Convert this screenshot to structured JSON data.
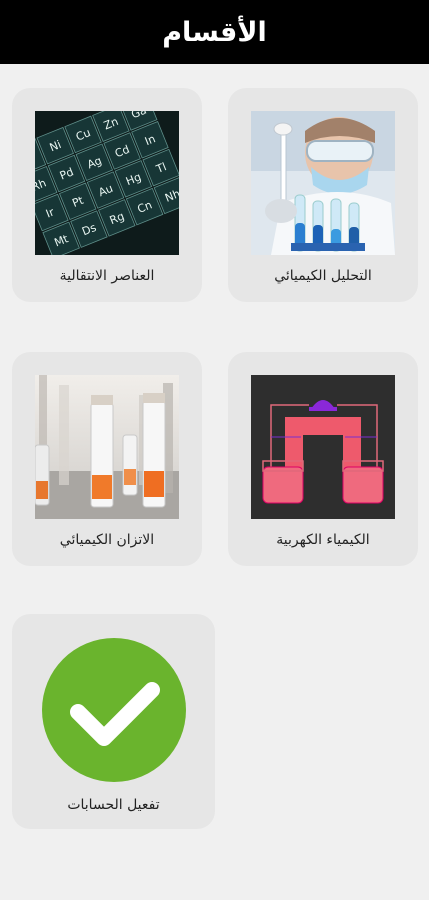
{
  "header": {
    "title": "الأقسام"
  },
  "sections": [
    {
      "label": "التحليل الكيميائي",
      "image_icon": "lab-analysis-photo"
    },
    {
      "label": "العناصر الانتقالية",
      "image_icon": "periodic-table-photo"
    },
    {
      "label": "الكيمياء الكهربية",
      "image_icon": "electrolysis-diagram"
    },
    {
      "label": "الاتزان الكيميائي",
      "image_icon": "test-tubes-photo"
    },
    {
      "label": "تفعيل الحسابات",
      "image_icon": "checkmark-circle-icon"
    }
  ],
  "periodic_symbols": [
    "Co",
    "Ni",
    "Cu",
    "Zn",
    "Ga",
    "Rh",
    "Pd",
    "Ag",
    "Cd",
    "In",
    "Ir",
    "Pt",
    "Au",
    "Hg",
    "Tl",
    "Mt",
    "Ds",
    "Rg",
    "Cn",
    "Nh"
  ],
  "colors": {
    "header_bg": "#000000",
    "page_bg": "#f0f0f0",
    "card_bg": "#e6e6e6",
    "check_green": "#6ab42d"
  }
}
